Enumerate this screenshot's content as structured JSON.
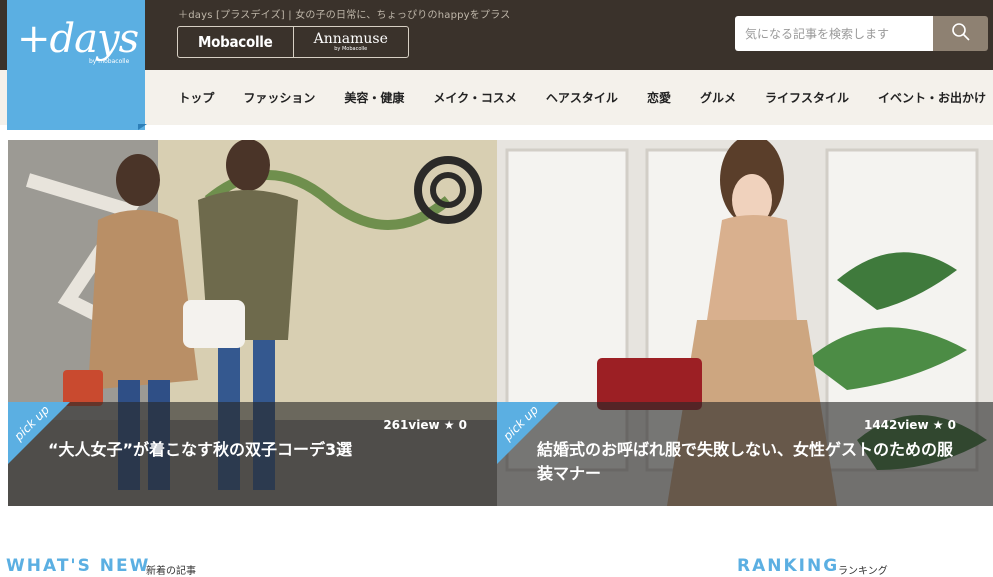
{
  "site": {
    "logo_text": "+days",
    "logo_sub": "by mobacolle",
    "tagline": "＋days [プラスデイズ] | 女の子の日常に、ちょっぴりのhappyをプラス",
    "brand_mobacolle": "Mobacolle",
    "brand_annamuse": "Annamuse",
    "brand_annamuse_sub": "by Mobacolle"
  },
  "search": {
    "placeholder": "気になる記事を検索します",
    "value": "",
    "button_icon": "search-icon"
  },
  "nav": {
    "items": [
      {
        "label": "トップ"
      },
      {
        "label": "ファッション"
      },
      {
        "label": "美容・健康"
      },
      {
        "label": "メイク・コスメ"
      },
      {
        "label": "ヘアスタイル"
      },
      {
        "label": "恋愛"
      },
      {
        "label": "グルメ"
      },
      {
        "label": "ライフスタイル"
      },
      {
        "label": "イベント・お出かけ"
      }
    ]
  },
  "pickup": {
    "badge": "pick up",
    "cards": [
      {
        "views": "261view ★ 0",
        "title": "“大人女子”が着こなす秋の双子コーデ3選",
        "image": "two-women-street-photo"
      },
      {
        "views": "1442view ★ 0",
        "title": "結婚式のお呼ばれ服で失敗しない、女性ゲストのための服装マナー",
        "image": "woman-lace-dress-photo"
      }
    ]
  },
  "sections": {
    "whats_new": "WHAT'S NEW",
    "whats_new_sub": "新着の記事",
    "ranking": "RANKING",
    "ranking_sub": "ランキング"
  },
  "colors": {
    "accent": "#5bafe2",
    "header_bg": "#3a322b",
    "nav_bg": "#f4f1eb",
    "search_btn": "#8e8172"
  }
}
